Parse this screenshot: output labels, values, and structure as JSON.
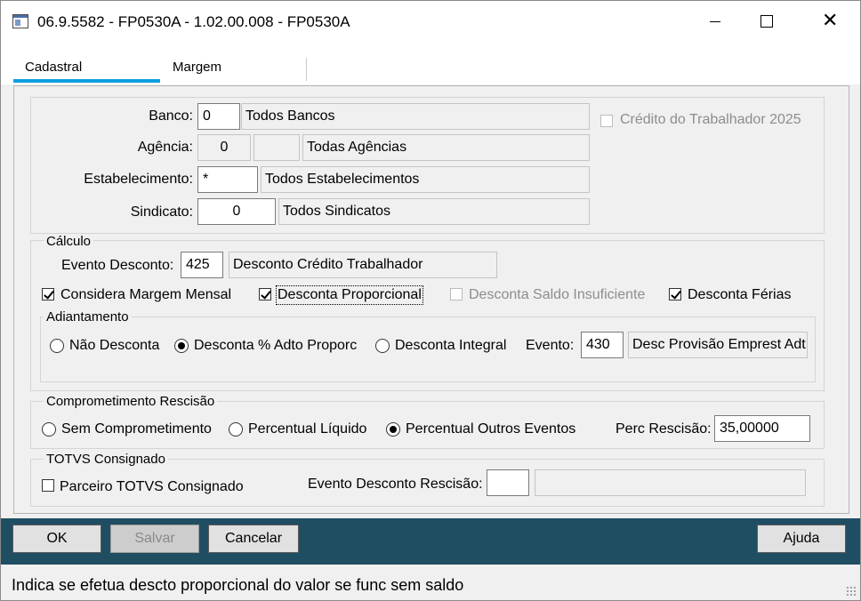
{
  "window": {
    "title": "06.9.5582 - FP0530A - 1.02.00.008 - FP0530A",
    "close_symbol": "✕"
  },
  "tabs": [
    {
      "label": "Cadastral"
    },
    {
      "label": "Margem"
    }
  ],
  "top": {
    "banco": {
      "label": "Banco:",
      "value": "0",
      "desc": "Todos Bancos"
    },
    "agencia": {
      "label": "Agência:",
      "value": "0",
      "value2": "",
      "desc": "Todas Agências"
    },
    "estabelecimento": {
      "label": "Estabelecimento:",
      "value": "*",
      "desc": "Todos Estabelecimentos"
    },
    "sindicato": {
      "label": "Sindicato:",
      "value": "0",
      "desc": "Todos Sindicatos"
    },
    "credito_label": "Crédito do Trabalhador 2025"
  },
  "calculo": {
    "legend": "Cálculo",
    "evento_label": "Evento Desconto:",
    "evento_value": "425",
    "evento_desc": "Desconto Crédito Trabalhador",
    "considera_margem": "Considera Margem Mensal",
    "desconta_proporcional": "Desconta Proporcional",
    "desconta_saldo": "Desconta Saldo Insuficiente",
    "desconta_ferias": "Desconta Férias"
  },
  "adiantamento": {
    "legend": "Adiantamento",
    "opt1": "Não Desconta",
    "opt2": "Desconta % Adto Proporc",
    "opt3": "Desconta Integral",
    "evento_label": "Evento:",
    "evento_value": "430",
    "evento_desc": "Desc Provisão Emprest Adt"
  },
  "rescisao": {
    "legend": "Comprometimento Rescisão",
    "opt1": "Sem Comprometimento",
    "opt2": "Percentual Líquido",
    "opt3": "Percentual Outros Eventos",
    "perc_label": "Perc Rescisão:",
    "perc_value": "35,00000"
  },
  "consignado": {
    "legend": "TOTVS Consignado",
    "parceiro": "Parceiro TOTVS Consignado",
    "evento_label": "Evento Desconto Rescisão:",
    "evento_value": "",
    "evento_desc": ""
  },
  "buttons": {
    "ok": "OK",
    "salvar": "Salvar",
    "cancelar": "Cancelar",
    "ajuda": "Ajuda"
  },
  "status": "Indica se efetua descto proporcional do valor se func sem saldo"
}
